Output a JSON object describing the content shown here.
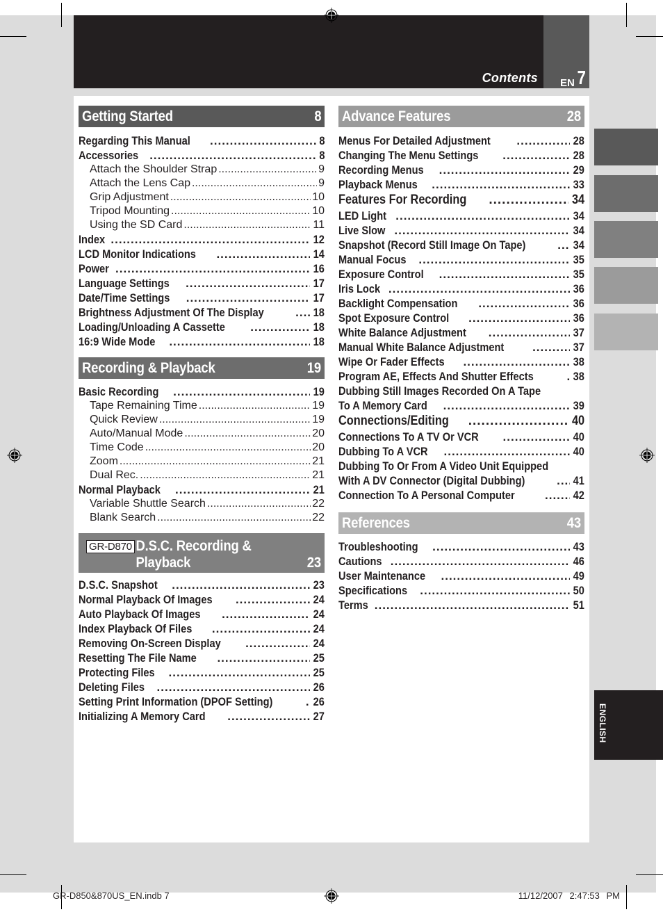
{
  "header": {
    "title": "Contents",
    "lang": "EN",
    "page": "7"
  },
  "colors": {
    "header_black": "#231f20",
    "header_gray": "#595959",
    "section_getting_started": "#595959",
    "section_recording": "#6d6d6d",
    "section_dsc": "#808080",
    "section_advance": "#9b9b9b",
    "section_references": "#b3b3b3",
    "page_bg": "#dcdcdc"
  },
  "sections": {
    "getting_started": {
      "title": "Getting Started",
      "page": "8",
      "items": [
        {
          "label": "Regarding This Manual",
          "page": "8",
          "level": 1
        },
        {
          "label": "Accessories",
          "page": "8",
          "level": 1
        },
        {
          "label": "Attach the Shoulder Strap",
          "page": "9",
          "level": 2
        },
        {
          "label": "Attach the Lens Cap",
          "page": "9",
          "level": 2
        },
        {
          "label": "Grip Adjustment",
          "page": "10",
          "level": 2
        },
        {
          "label": "Tripod Mounting",
          "page": "10",
          "level": 2
        },
        {
          "label": "Using the SD Card",
          "page": "11",
          "level": 2
        },
        {
          "label": "Index",
          "page": "12",
          "level": 1
        },
        {
          "label": "LCD Monitor Indications",
          "page": "14",
          "level": 1
        },
        {
          "label": "Power",
          "page": "16",
          "level": 1
        },
        {
          "label": "Language Settings",
          "page": "17",
          "level": 1
        },
        {
          "label": "Date/Time Settings",
          "page": "17",
          "level": 1
        },
        {
          "label": "Brightness Adjustment Of The Display",
          "page": "18",
          "level": 1
        },
        {
          "label": "Loading/Unloading A Cassette",
          "page": "18",
          "level": 1
        },
        {
          "label": "16:9 Wide Mode",
          "page": "18",
          "level": 1
        }
      ]
    },
    "recording_playback": {
      "title": "Recording & Playback",
      "page": "19",
      "items": [
        {
          "label": "Basic Recording",
          "page": "19",
          "level": 1
        },
        {
          "label": "Tape Remaining Time",
          "page": "19",
          "level": 2
        },
        {
          "label": "Quick Review",
          "page": "19",
          "level": 2
        },
        {
          "label": "Auto/Manual Mode",
          "page": "20",
          "level": 2
        },
        {
          "label": "Time Code",
          "page": "20",
          "level": 2
        },
        {
          "label": "Zoom",
          "page": "21",
          "level": 2
        },
        {
          "label": "Dual Rec.",
          "page": "21",
          "level": 2
        },
        {
          "label": "Normal Playback",
          "page": "21",
          "level": 1
        },
        {
          "label": "Variable Shuttle Search",
          "page": "22",
          "level": 2
        },
        {
          "label": "Blank Search",
          "page": "22",
          "level": 2
        }
      ]
    },
    "dsc": {
      "model": "GR-D870",
      "title_line1": "D.S.C. Recording &",
      "title_line2": "Playback",
      "page": "23",
      "items": [
        {
          "label": "D.S.C. Snapshot",
          "page": "23",
          "level": 1
        },
        {
          "label": "Normal Playback Of Images",
          "page": "24",
          "level": 1
        },
        {
          "label": "Auto Playback Of Images",
          "page": "24",
          "level": 1
        },
        {
          "label": "Index Playback Of Files",
          "page": "24",
          "level": 1
        },
        {
          "label": "Removing On-Screen Display",
          "page": "24",
          "level": 1
        },
        {
          "label": "Resetting The File Name",
          "page": "25",
          "level": 1
        },
        {
          "label": "Protecting Files",
          "page": "25",
          "level": 1
        },
        {
          "label": "Deleting Files",
          "page": "26",
          "level": 1
        },
        {
          "label": "Setting Print Information (DPOF Setting)",
          "page": "26",
          "level": 1
        },
        {
          "label": "Initializing A Memory Card",
          "page": "27",
          "level": 1
        }
      ]
    },
    "advance": {
      "title": "Advance Features",
      "page": "28",
      "items": [
        {
          "label": "Menus For Detailed Adjustment",
          "page": "28",
          "level": 1
        },
        {
          "label": "Changing The Menu Settings",
          "page": "28",
          "level": 1
        },
        {
          "label": "Recording Menus",
          "page": "29",
          "level": 1
        },
        {
          "label": "Playback Menus",
          "page": "33",
          "level": 1
        },
        {
          "label": "Features For Recording",
          "page": "34",
          "level": 0
        },
        {
          "label": "LED Light",
          "page": "34",
          "level": 1
        },
        {
          "label": "Live Slow",
          "page": "34",
          "level": 1
        },
        {
          "label": "Snapshot (Record Still Image On Tape)",
          "page": "34",
          "level": 1
        },
        {
          "label": "Manual Focus",
          "page": "35",
          "level": 1
        },
        {
          "label": "Exposure Control",
          "page": "35",
          "level": 1
        },
        {
          "label": "Iris Lock",
          "page": "36",
          "level": 1
        },
        {
          "label": "Backlight Compensation",
          "page": "36",
          "level": 1
        },
        {
          "label": "Spot Exposure Control",
          "page": "36",
          "level": 1
        },
        {
          "label": "White Balance Adjustment",
          "page": "37",
          "level": 1
        },
        {
          "label": "Manual White Balance Adjustment",
          "page": "37",
          "level": 1
        },
        {
          "label": "Wipe Or Fader Effects",
          "page": "38",
          "level": 1
        },
        {
          "label": "Program AE, Effects And Shutter Effects",
          "page": "38",
          "level": 1
        },
        {
          "label": "Dubbing Still Images Recorded On A Tape",
          "page": "",
          "level": 1
        },
        {
          "label": "To A Memory Card",
          "page": "39",
          "level": 1
        },
        {
          "label": "Connections/Editing",
          "page": "40",
          "level": 0
        },
        {
          "label": "Connections To A TV Or VCR",
          "page": "40",
          "level": 1
        },
        {
          "label": "Dubbing To A VCR",
          "page": "40",
          "level": 1
        },
        {
          "label": "Dubbing To Or From A Video Unit Equipped",
          "page": "",
          "level": 1
        },
        {
          "label": "With A DV Connector (Digital Dubbing)",
          "page": "41",
          "level": 1
        },
        {
          "label": "Connection To A Personal Computer",
          "page": "42",
          "level": 1
        }
      ]
    },
    "references": {
      "title": "References",
      "page": "43",
      "items": [
        {
          "label": "Troubleshooting",
          "page": "43",
          "level": 1
        },
        {
          "label": "Cautions",
          "page": "46",
          "level": 1
        },
        {
          "label": "User Maintenance",
          "page": "49",
          "level": 1
        },
        {
          "label": "Specifications",
          "page": "50",
          "level": 1
        },
        {
          "label": "Terms",
          "page": "51",
          "level": 1
        }
      ]
    }
  },
  "side_tabs": [
    "#595959",
    "#6d6d6d",
    "#808080",
    "#9b9b9b",
    "#b3b3b3"
  ],
  "language_tab": "ENGLISH",
  "footer": {
    "file": "GR-D850&870US_EN.indb   7",
    "timestamp": "11/12/2007   2:47:53 PM"
  }
}
